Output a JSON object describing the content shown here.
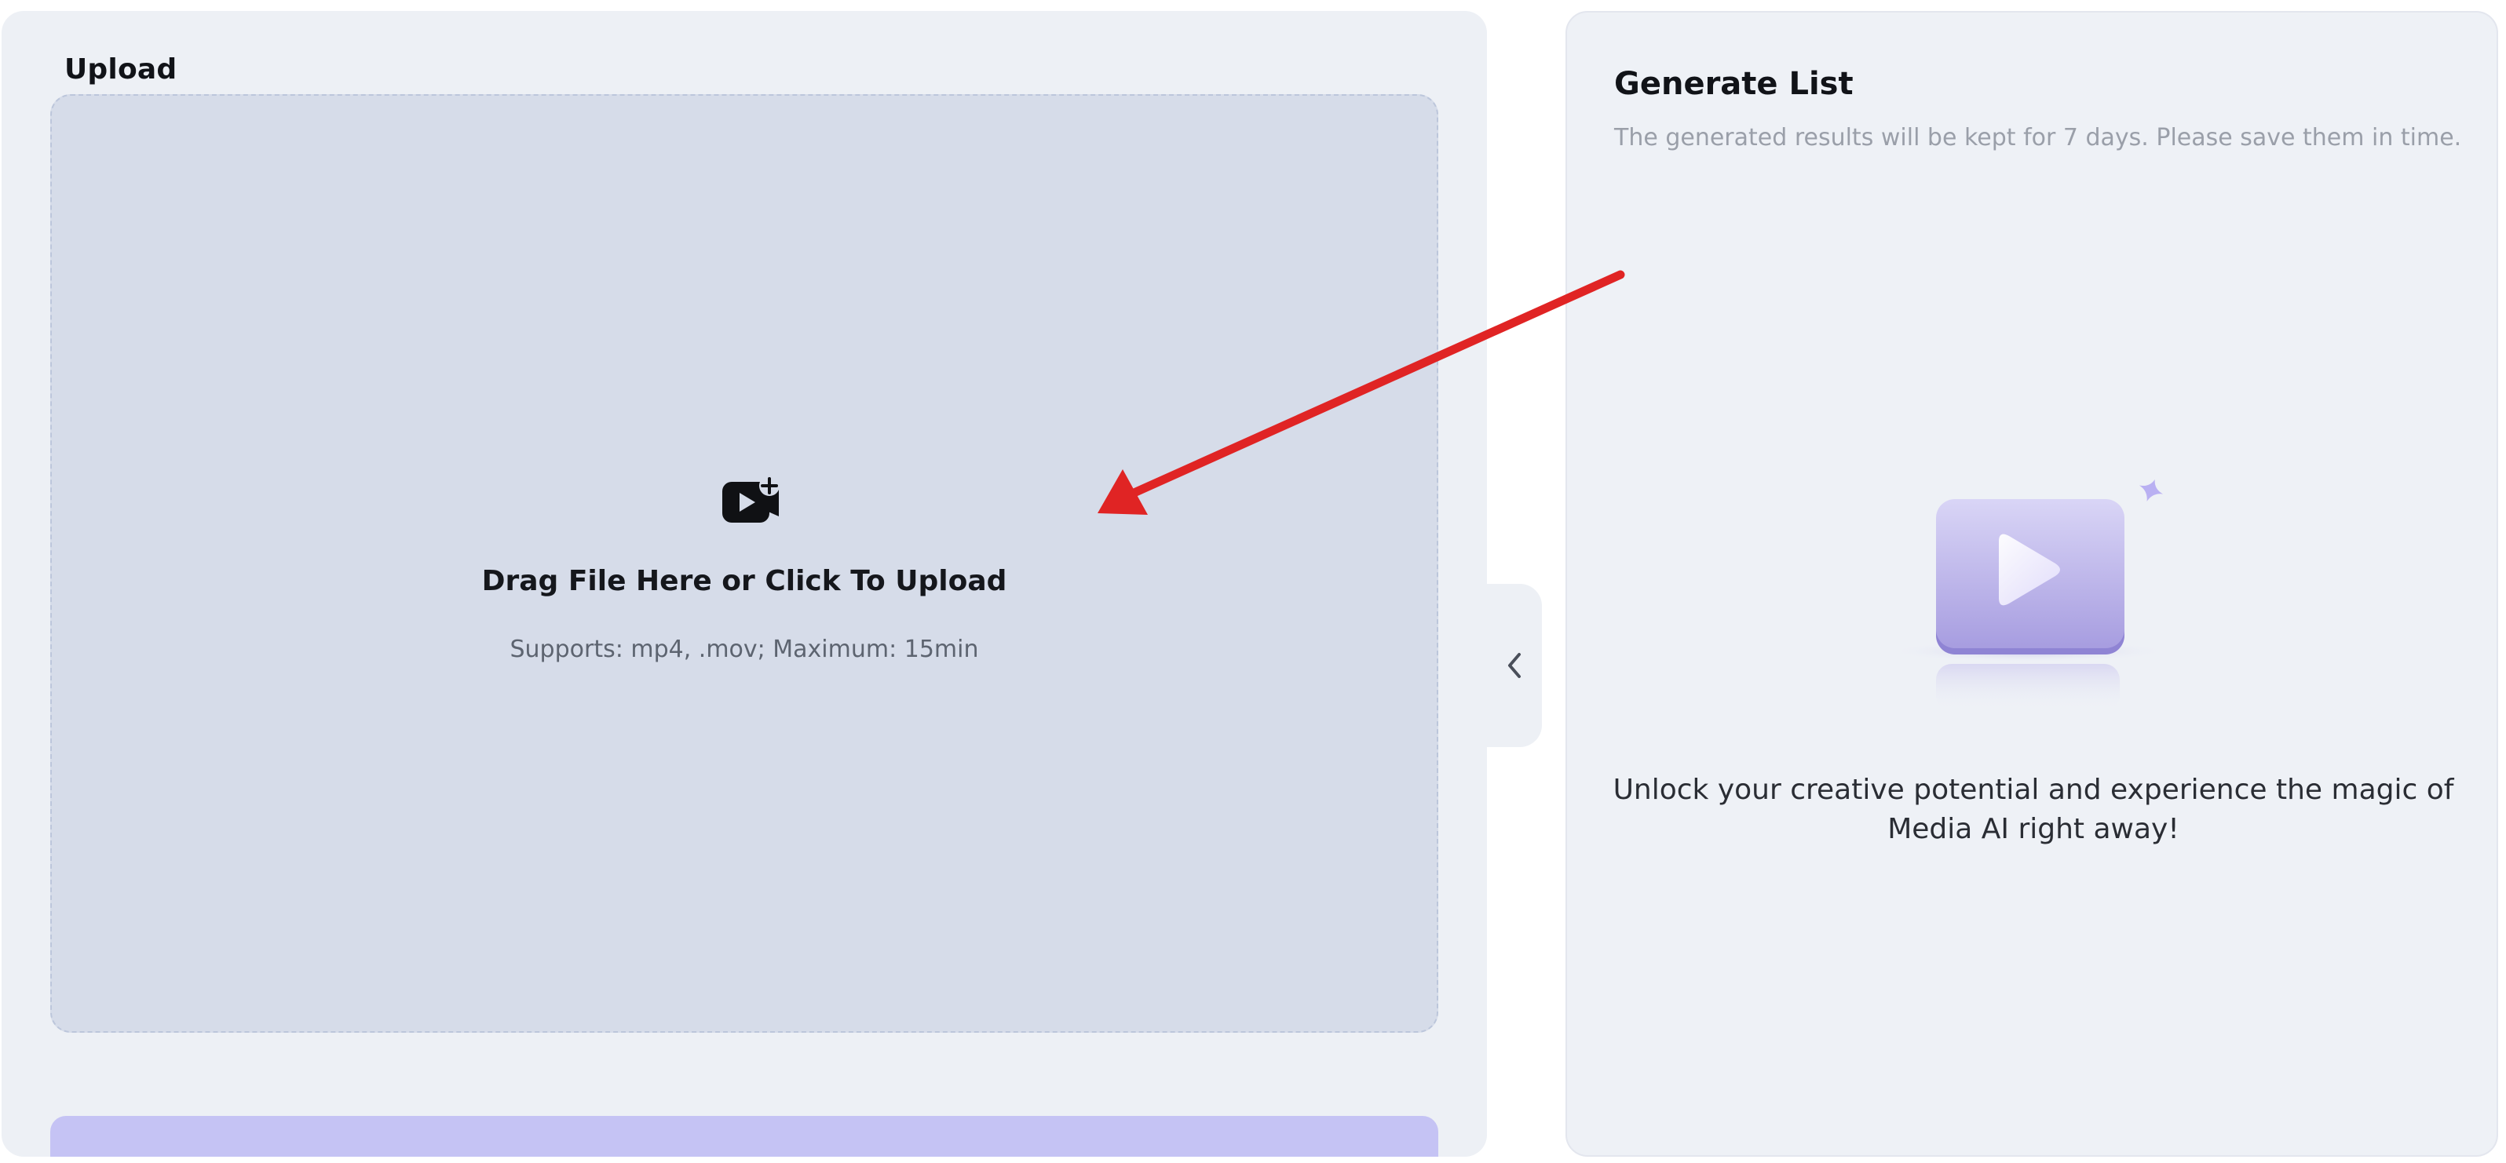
{
  "upload": {
    "title": "Upload",
    "dropzone": {
      "icon": "video-add-icon",
      "title": "Drag File Here or Click To Upload",
      "subtitle": "Supports: mp4, .mov; Maximum: 15min"
    }
  },
  "generate_list": {
    "title": "Generate List",
    "subtitle": "The generated results will be kept for 7 days. Please save them in time.",
    "empty_icon": "video-play-illustration",
    "empty_message": "Unlock your creative potential and experience the magic of Media AI right away!"
  },
  "collapse_icon": "chevron-left-icon",
  "colors": {
    "accent": "#c5c3f4",
    "annotation_arrow": "#e02424"
  }
}
